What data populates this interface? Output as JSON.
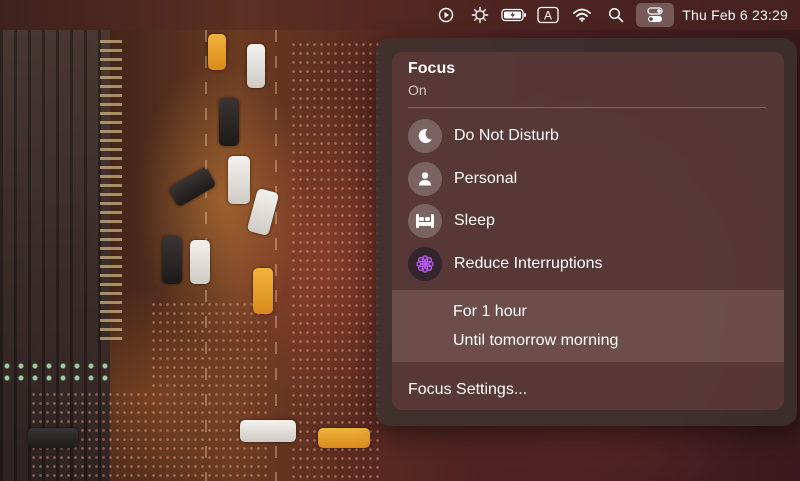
{
  "menubar": {
    "icons": [
      "play-circle-icon",
      "gear-sun-icon",
      "battery-icon",
      "input-source-icon",
      "wifi-icon",
      "search-icon",
      "control-center-icon"
    ],
    "input_source_label": "A",
    "clock": "Thu Feb 6  23:29"
  },
  "focus_panel": {
    "title": "Focus",
    "status": "On",
    "modes": [
      {
        "label": "Do Not Disturb",
        "icon": "moon-icon"
      },
      {
        "label": "Personal",
        "icon": "person-icon"
      },
      {
        "label": "Sleep",
        "icon": "bed-icon"
      },
      {
        "label": "Reduce Interruptions",
        "icon": "flower-icon",
        "selected": true
      }
    ],
    "duration_options": [
      {
        "label": "For 1 hour"
      },
      {
        "label": "Until tomorrow morning"
      }
    ],
    "settings_label": "Focus Settings..."
  },
  "colors": {
    "active_mode_accent": "#b65cf0"
  }
}
